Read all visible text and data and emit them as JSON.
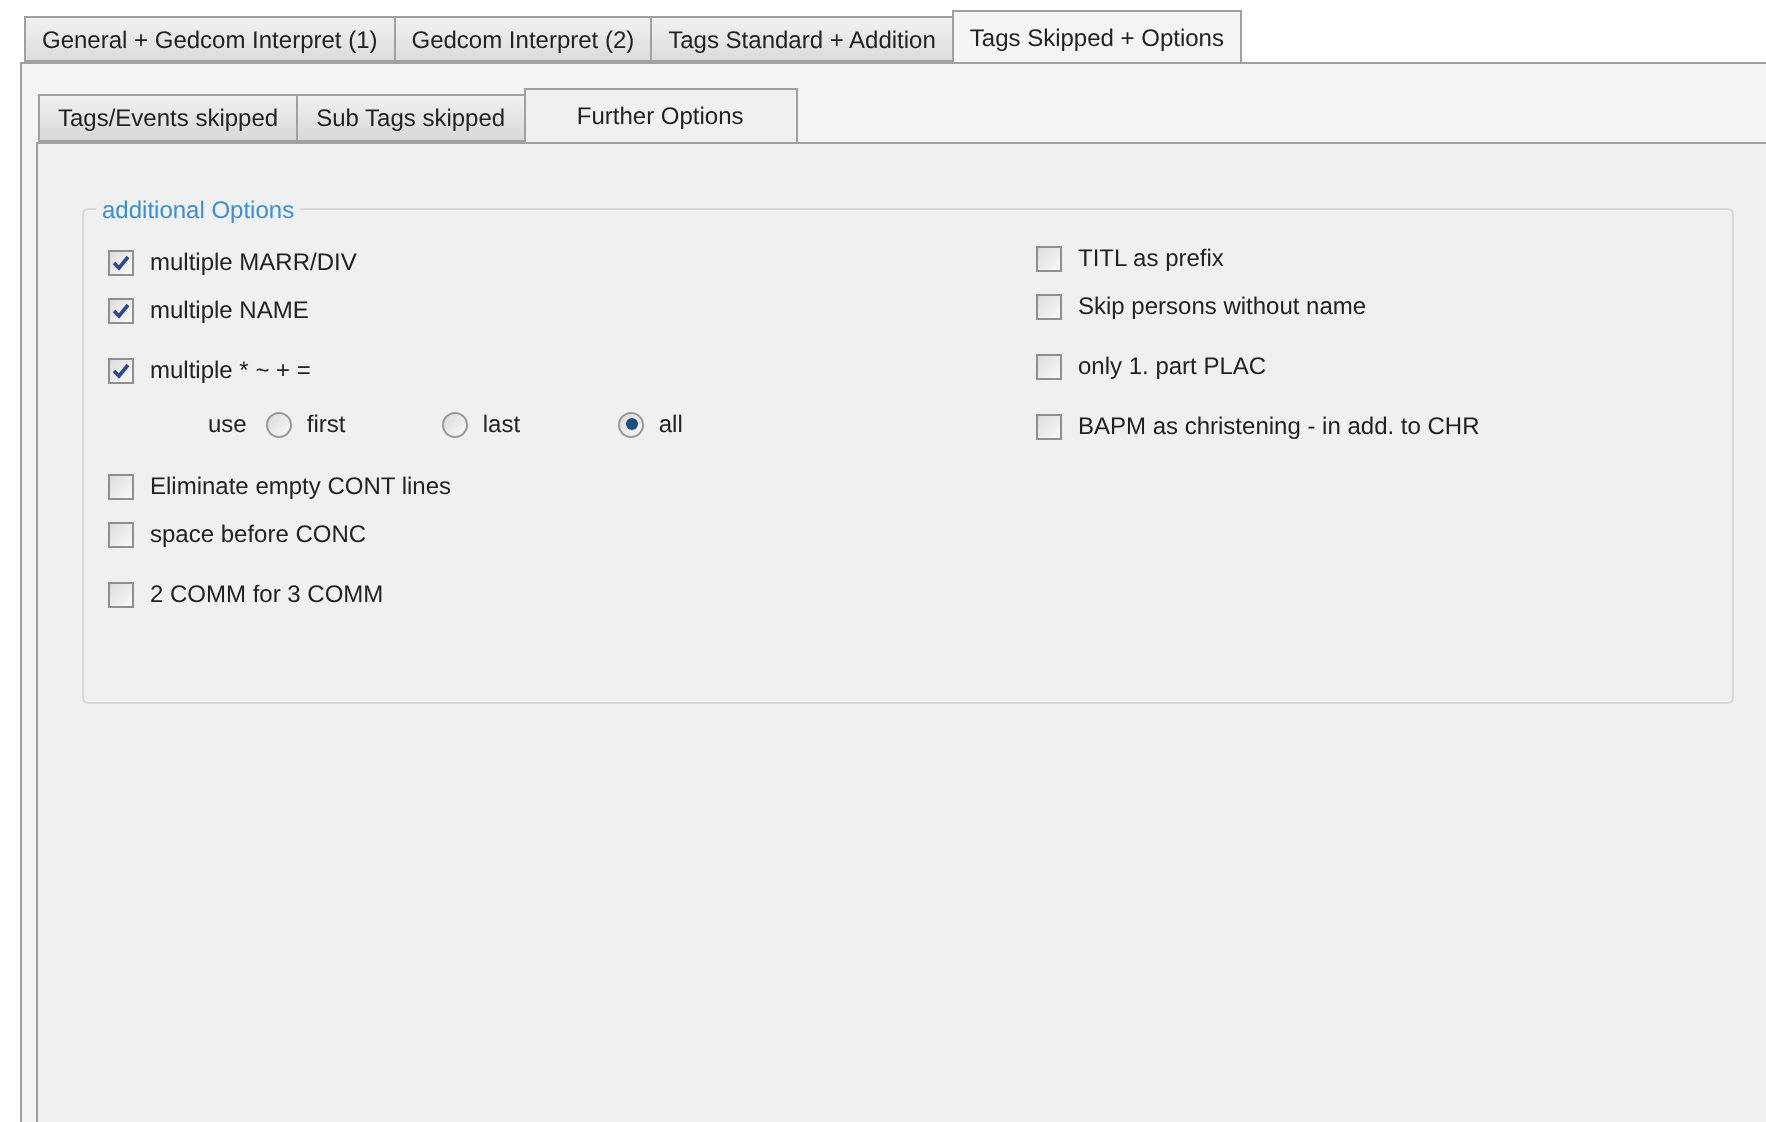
{
  "main_tabs": [
    {
      "label": "General + Gedcom Interpret (1)",
      "selected": false
    },
    {
      "label": "Gedcom Interpret (2)",
      "selected": false
    },
    {
      "label": "Tags Standard + Addition",
      "selected": false
    },
    {
      "label": "Tags Skipped + Options",
      "selected": true
    }
  ],
  "sub_tabs": [
    {
      "label": "Tags/Events skipped",
      "selected": false
    },
    {
      "label": "Sub Tags skipped",
      "selected": false
    },
    {
      "label": "Further Options",
      "selected": true
    }
  ],
  "group": {
    "title": "additional Options",
    "left_column": [
      {
        "kind": "checkbox",
        "label": "multiple MARR/DIV",
        "checked": true
      },
      {
        "kind": "checkbox",
        "label": "multiple NAME",
        "checked": true
      },
      {
        "kind": "checkbox",
        "label": "multiple * ~ + =",
        "checked": true
      },
      {
        "kind": "radio_group",
        "label": "use",
        "options": [
          {
            "label": "first",
            "selected": false
          },
          {
            "label": "last",
            "selected": false
          },
          {
            "label": "all",
            "selected": true
          }
        ]
      },
      {
        "kind": "checkbox",
        "label": "Eliminate empty CONT lines",
        "checked": false
      },
      {
        "kind": "checkbox",
        "label": "space before CONC",
        "checked": false
      },
      {
        "kind": "checkbox",
        "label": "2 COMM for 3 COMM",
        "checked": false
      }
    ],
    "right_column": [
      {
        "kind": "checkbox",
        "label": "TITL as prefix",
        "checked": false
      },
      {
        "kind": "checkbox",
        "label": "Skip persons without name",
        "checked": false
      },
      {
        "kind": "checkbox",
        "label": "only 1. part PLAC",
        "checked": false
      },
      {
        "kind": "checkbox",
        "label": "BAPM as christening - in add. to CHR",
        "checked": false
      }
    ]
  }
}
